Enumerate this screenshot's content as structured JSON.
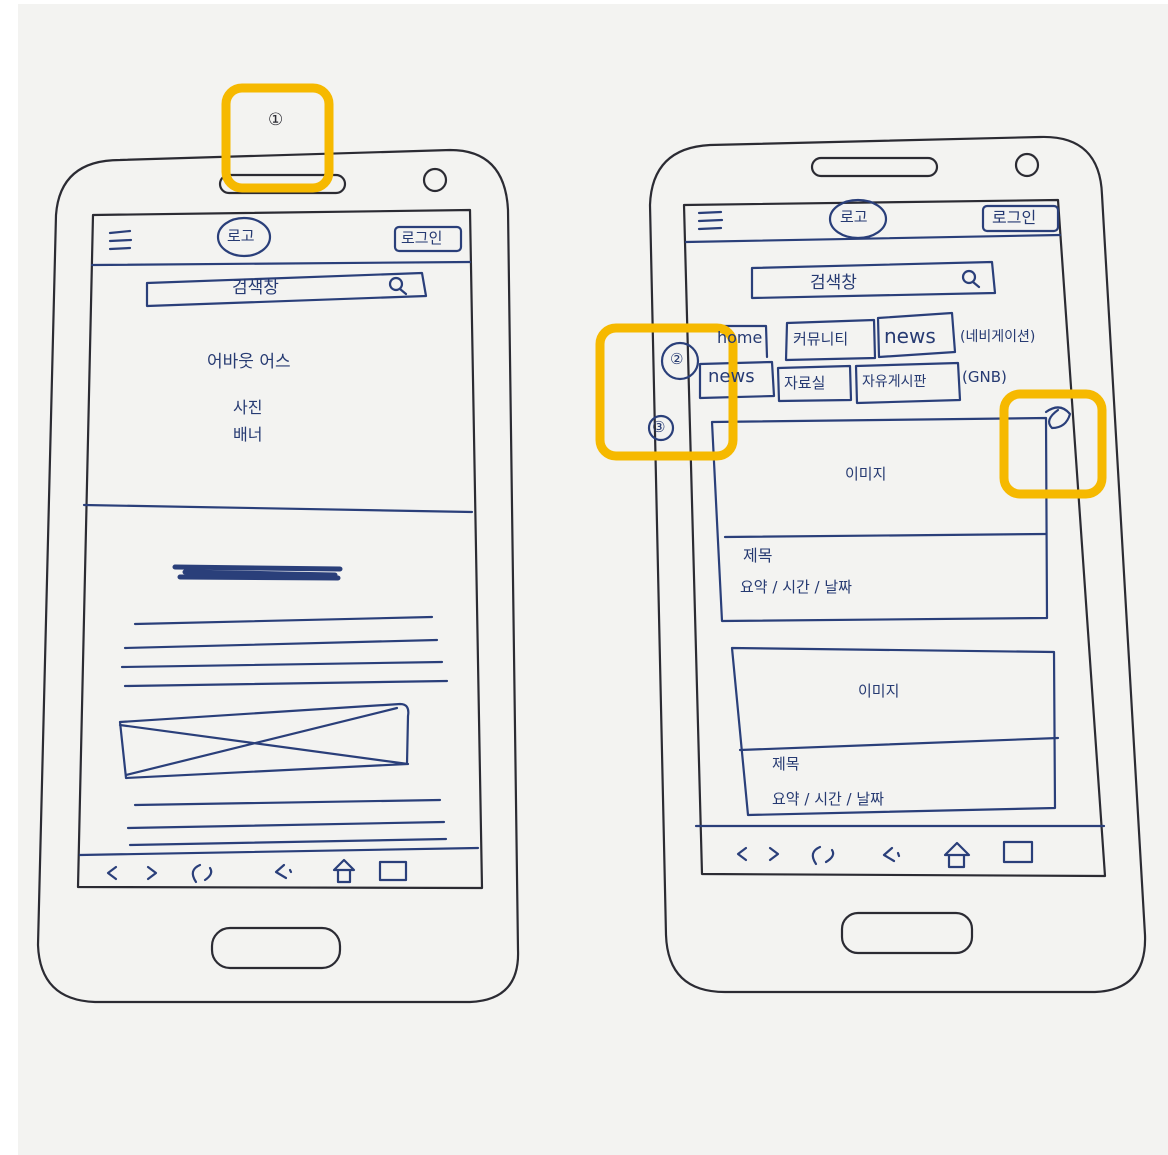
{
  "left_phone": {
    "marker": "①",
    "logo": "로고",
    "login": "로그인",
    "search": {
      "placeholder": "검색창",
      "icon": "search-icon"
    },
    "banner": [
      "어바웃 어스",
      "사진",
      "배너"
    ],
    "nav_icons": [
      "back-icon",
      "forward-icon",
      "refresh-icon",
      "share-icon",
      "home-icon",
      "tabs-icon"
    ]
  },
  "right_phone": {
    "logo": "로고",
    "login": "로그인",
    "search": {
      "placeholder": "검색창",
      "icon": "search-icon"
    },
    "nav_row1": [
      "home",
      "커뮤니티",
      "news"
    ],
    "nav_row1_note": "(네비게이션)",
    "nav_row2": [
      "news",
      "자료실",
      "자유게시판"
    ],
    "nav_row2_note": "(GNB)",
    "marker_2": "②",
    "marker_3": "③",
    "cards": [
      {
        "image": "이미지",
        "title": "제목",
        "meta": "요약 / 시간 / 날짜"
      },
      {
        "image": "이미지",
        "title": "제목",
        "meta": "요약 / 시간 / 날짜"
      }
    ],
    "nav_icons": [
      "back-icon",
      "forward-icon",
      "refresh-icon",
      "share-icon",
      "home-icon",
      "tabs-icon"
    ]
  },
  "colors": {
    "highlight": "#f6b900",
    "ink": "#2a3f7a",
    "paper": "#f3f3f1"
  }
}
